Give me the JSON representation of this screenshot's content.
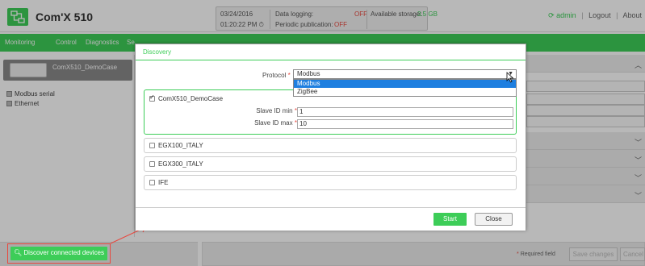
{
  "app": {
    "title": "Com'X 510",
    "logo_icon": "network-icon"
  },
  "status": {
    "date": "03/24/2016",
    "time": "01:20:22 PM",
    "clock_icon": "clock-icon",
    "data_logging_label": "Data logging:",
    "data_logging_value": "OFF",
    "periodic_label": "Periodic publication:",
    "periodic_value": "OFF",
    "storage_label": "Available storage:",
    "storage_value": "3.5 GB"
  },
  "user": {
    "name": "admin",
    "logout": "Logout",
    "about": "About"
  },
  "nav": {
    "tabs": [
      "Monitoring",
      "Control",
      "Diagnostics",
      "Se"
    ]
  },
  "left": {
    "device_name": "ComX510_DemoCase",
    "tree": [
      "Modbus serial",
      "Ethernet"
    ]
  },
  "dialog": {
    "title": "Discovery",
    "protocol_label": "Protocol",
    "protocol_value": "Modbus",
    "protocol_options": [
      "Modbus",
      "ZigBee"
    ],
    "devices": [
      {
        "name": "ComX510_DemoCase",
        "checked": true
      },
      {
        "name": "EGX100_ITALY",
        "checked": false
      },
      {
        "name": "EGX300_ITALY",
        "checked": false
      },
      {
        "name": "IFE",
        "checked": false
      }
    ],
    "slave_min_label": "Slave ID min",
    "slave_min_value": "1",
    "slave_max_label": "Slave ID max",
    "slave_max_value": "10",
    "start": "Start",
    "close": "Close"
  },
  "bottom": {
    "discover": "Discover connected devices",
    "required": "Required field",
    "save": "Save changes",
    "cancel": "Cancel"
  },
  "colors": {
    "brand_green": "#3dcd58",
    "off_red": "#e8483f",
    "select_blue": "#1e7fe0"
  }
}
